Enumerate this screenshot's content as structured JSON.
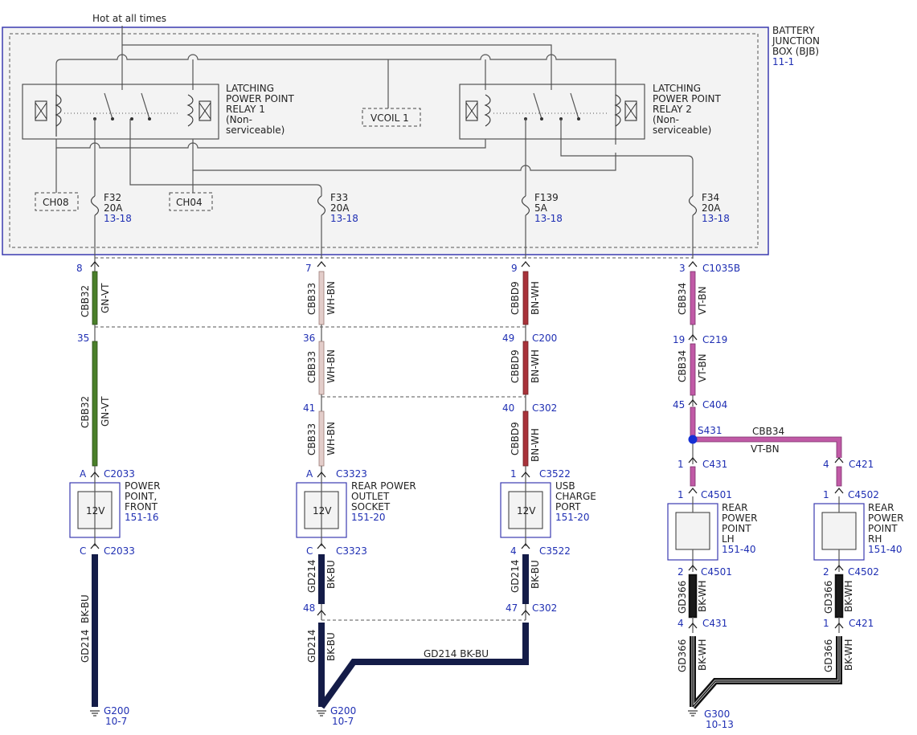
{
  "header": {
    "hot_label": "Hot at all times"
  },
  "bjb": {
    "name_lines": [
      "BATTERY",
      "JUNCTION",
      "BOX (BJB)"
    ],
    "ref": "11-1"
  },
  "relays": [
    {
      "name_lines": [
        "LATCHING",
        "POWER POINT",
        "RELAY 1",
        "(Non-",
        "serviceable)"
      ]
    },
    {
      "name_lines": [
        "LATCHING",
        "POWER POINT",
        "RELAY 2",
        "(Non-",
        "serviceable)"
      ]
    }
  ],
  "vcoil": "VCOIL 1",
  "ch_boxes": [
    "CH08",
    "CH04"
  ],
  "fuses": [
    {
      "id": "F32",
      "rating": "20A",
      "ref": "13-18"
    },
    {
      "id": "F33",
      "rating": "20A",
      "ref": "13-18"
    },
    {
      "id": "F139",
      "rating": "5A",
      "ref": "13-18"
    },
    {
      "id": "F34",
      "rating": "20A",
      "ref": "13-18"
    }
  ],
  "colors": {
    "border_blue": "#3b3bb0",
    "gn_vt": "#4a7f2a",
    "wh_bn": "#c9a9a5",
    "bn_wh": "#a8323a",
    "vt_bn": "#c05aa6",
    "bk_bu": "#141c48",
    "bk_wh": "#1a1a1a",
    "ref_blue": "#1f2fb3"
  },
  "connectors": {
    "c1035b": "C1035B",
    "c200": "C200",
    "c302": "C302",
    "c219": "C219",
    "c404": "C404",
    "c2033": "C2033",
    "c3323": "C3323",
    "c3522": "C3522",
    "c431": "C431",
    "c421": "C421",
    "c4501": "C4501",
    "c4502": "C4502"
  },
  "pins": {
    "p8": "8",
    "p7": "7",
    "p9": "9",
    "p3": "3",
    "p35": "35",
    "p36": "36",
    "p49": "49",
    "p19": "19",
    "p41": "41",
    "p40": "40",
    "p45": "45",
    "pA1": "A",
    "pA2": "A",
    "p1_3522": "1",
    "pC1": "C",
    "pC2": "C",
    "p4_3522": "4",
    "p48": "48",
    "p47": "47",
    "p1_431": "1",
    "p4_421": "4",
    "p1_4501": "1",
    "p1_4502": "1",
    "p2_4501": "2",
    "p2_4502": "2",
    "p4_431": "4",
    "p1_421": "1"
  },
  "circuits": {
    "cbb32": "CBB32",
    "gn_vt": "GN-VT",
    "cbb33": "CBB33",
    "wh_bn": "WH-BN",
    "cbbd9": "CBBD9",
    "bn_wh": "BN-WH",
    "cbb34": "CBB34",
    "vt_bn": "VT-BN",
    "gd214": "GD214",
    "bk_bu": "BK-BU",
    "gd366": "GD366",
    "bk_wh": "BK-WH",
    "gd214_bk_bu_h": "GD214  BK-BU"
  },
  "splice": {
    "id": "S431",
    "circuit": "CBB34",
    "color": "VT-BN"
  },
  "components": [
    {
      "name_lines": [
        "POWER",
        "POINT,",
        "FRONT"
      ],
      "ref": "151-16",
      "label": "12V"
    },
    {
      "name_lines": [
        "REAR POWER",
        "OUTLET",
        "SOCKET"
      ],
      "ref": "151-20",
      "label": "12V"
    },
    {
      "name_lines": [
        "USB",
        "CHARGE",
        "PORT"
      ],
      "ref": "151-20",
      "label": "12V"
    },
    {
      "name_lines": [
        "REAR",
        "POWER",
        "POINT",
        "LH"
      ],
      "ref": "151-40"
    },
    {
      "name_lines": [
        "REAR",
        "POWER",
        "POINT",
        "RH"
      ],
      "ref": "151-40"
    }
  ],
  "grounds": [
    {
      "id": "G200",
      "ref": "10-7"
    },
    {
      "id": "G200",
      "ref": "10-7"
    },
    {
      "id": "G300",
      "ref": "10-13"
    }
  ]
}
